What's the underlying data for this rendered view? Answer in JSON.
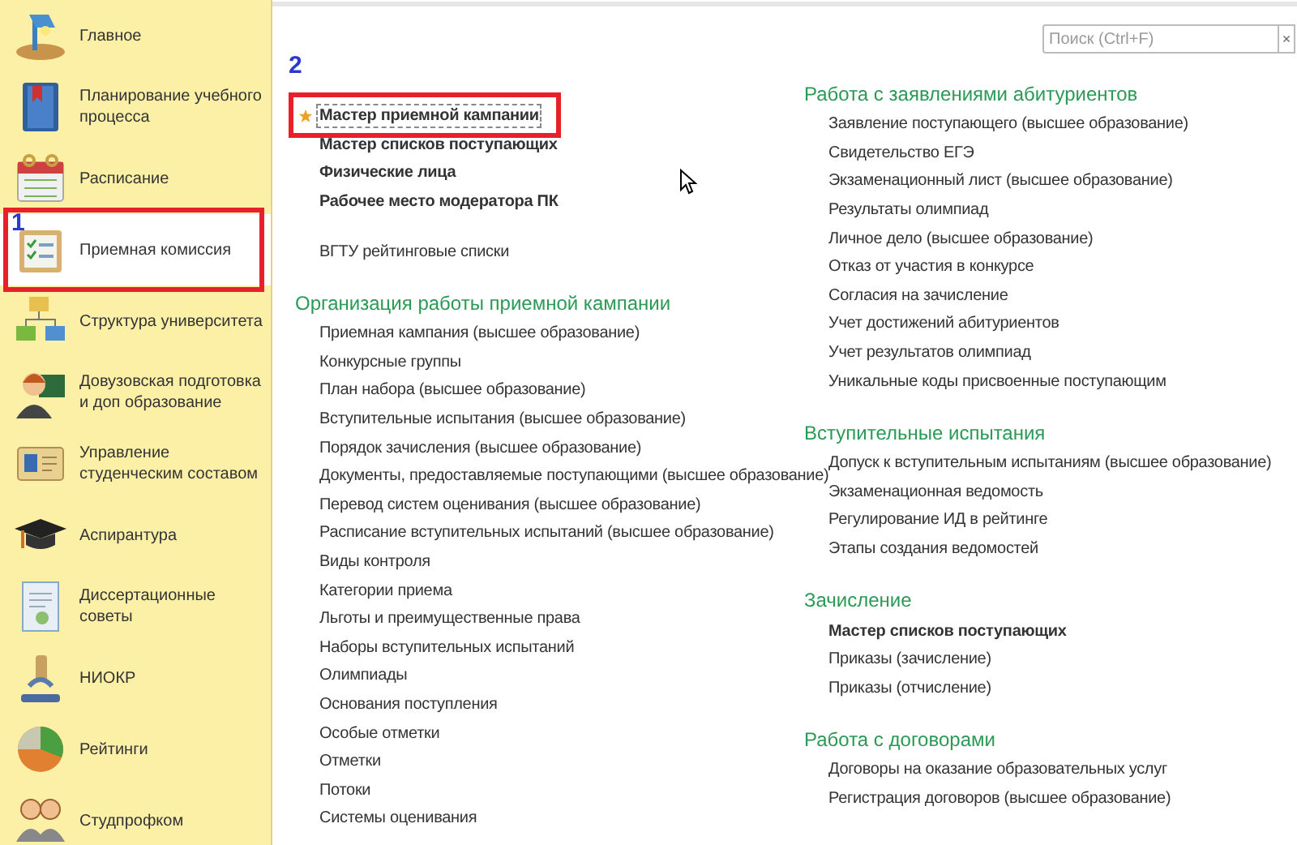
{
  "sidebar": {
    "items": [
      {
        "label": "Главное",
        "selected": false
      },
      {
        "label": "Планирование учебного процесса",
        "selected": false
      },
      {
        "label": "Расписание",
        "selected": false
      },
      {
        "label": "Приемная комиссия",
        "selected": true,
        "annotation": "1"
      },
      {
        "label": "Структура университета",
        "selected": false
      },
      {
        "label": "Довузовская подготовка и доп образование",
        "selected": false
      },
      {
        "label": "Управление студенческим составом",
        "selected": false
      },
      {
        "label": "Аспирантура",
        "selected": false
      },
      {
        "label": "Диссертационные советы",
        "selected": false
      },
      {
        "label": "НИОКР",
        "selected": false
      },
      {
        "label": "Рейтинги",
        "selected": false
      },
      {
        "label": "Студпрофком",
        "selected": false
      }
    ]
  },
  "search": {
    "placeholder": "Поиск (Ctrl+F)",
    "clear": "×"
  },
  "columns": [
    {
      "groups": [
        {
          "items": [
            {
              "label": "Мастер приемной кампании",
              "bold": true,
              "favorite": true,
              "focused": true,
              "annotation": "2"
            },
            {
              "label": "Мастер списков поступающих",
              "bold": true,
              "favorite": false,
              "focused": false
            },
            {
              "label": "Физические лица",
              "bold": true,
              "favorite": false,
              "focused": false
            },
            {
              "label": "Рабочее место модератора ПК",
              "bold": true,
              "favorite": false,
              "focused": false
            }
          ]
        },
        {
          "items": [
            {
              "label": "ВГТУ рейтинговые списки",
              "bold": false,
              "favorite": false,
              "focused": false
            }
          ]
        },
        {
          "heading": "Организация работы приемной кампании",
          "items": [
            {
              "label": "Приемная кампания (высшее образование)",
              "bold": false,
              "favorite": false,
              "focused": false
            },
            {
              "label": "Конкурсные группы",
              "bold": false,
              "favorite": false,
              "focused": false
            },
            {
              "label": "План набора (высшее образование)",
              "bold": false,
              "favorite": false,
              "focused": false
            },
            {
              "label": "Вступительные испытания (высшее образование)",
              "bold": false,
              "favorite": false,
              "focused": false
            },
            {
              "label": "Порядок зачисления (высшее образование)",
              "bold": false,
              "favorite": false,
              "focused": false
            },
            {
              "label": "Документы, предоставляемые поступающими (высшее образование)",
              "bold": false,
              "favorite": false,
              "focused": false
            },
            {
              "label": "Перевод систем оценивания (высшее образование)",
              "bold": false,
              "favorite": false,
              "focused": false
            },
            {
              "label": "Расписание вступительных испытаний (высшее образование)",
              "bold": false,
              "favorite": false,
              "focused": false
            },
            {
              "label": "Виды контроля",
              "bold": false,
              "favorite": false,
              "focused": false
            },
            {
              "label": "Категории приема",
              "bold": false,
              "favorite": false,
              "focused": false
            },
            {
              "label": "Льготы и преимущественные права",
              "bold": false,
              "favorite": false,
              "focused": false
            },
            {
              "label": "Наборы вступительных испытаний",
              "bold": false,
              "favorite": false,
              "focused": false
            },
            {
              "label": "Олимпиады",
              "bold": false,
              "favorite": false,
              "focused": false
            },
            {
              "label": "Основания поступления",
              "bold": false,
              "favorite": false,
              "focused": false
            },
            {
              "label": "Особые отметки",
              "bold": false,
              "favorite": false,
              "focused": false
            },
            {
              "label": "Отметки",
              "bold": false,
              "favorite": false,
              "focused": false
            },
            {
              "label": "Потоки",
              "bold": false,
              "favorite": false,
              "focused": false
            },
            {
              "label": "Системы оценивания",
              "bold": false,
              "favorite": false,
              "focused": false
            }
          ]
        }
      ]
    },
    {
      "groups": [
        {
          "heading": "Работа с заявлениями абитуриентов",
          "items": [
            {
              "label": "Заявление поступающего (высшее образование)",
              "bold": false,
              "favorite": false,
              "focused": false
            },
            {
              "label": "Свидетельство ЕГЭ",
              "bold": false,
              "favorite": false,
              "focused": false
            },
            {
              "label": "Экзаменационный лист (высшее образование)",
              "bold": false,
              "favorite": false,
              "focused": false
            },
            {
              "label": "Результаты олимпиад",
              "bold": false,
              "favorite": false,
              "focused": false
            },
            {
              "label": "Личное дело (высшее образование)",
              "bold": false,
              "favorite": false,
              "focused": false
            },
            {
              "label": "Отказ от участия в конкурсе",
              "bold": false,
              "favorite": false,
              "focused": false
            },
            {
              "label": "Согласия на зачисление",
              "bold": false,
              "favorite": false,
              "focused": false
            },
            {
              "label": "Учет достижений абитуриентов",
              "bold": false,
              "favorite": false,
              "focused": false
            },
            {
              "label": "Учет результатов олимпиад",
              "bold": false,
              "favorite": false,
              "focused": false
            },
            {
              "label": "Уникальные коды присвоенные поступающим",
              "bold": false,
              "favorite": false,
              "focused": false
            }
          ]
        },
        {
          "heading": "Вступительные испытания",
          "items": [
            {
              "label": "Допуск к вступительным испытаниям (высшее образование)",
              "bold": false,
              "favorite": false,
              "focused": false
            },
            {
              "label": "Экзаменационная ведомость",
              "bold": false,
              "favorite": false,
              "focused": false
            },
            {
              "label": "Регулирование ИД в рейтинге",
              "bold": false,
              "favorite": false,
              "focused": false
            },
            {
              "label": "Этапы создания ведомостей",
              "bold": false,
              "favorite": false,
              "focused": false
            }
          ]
        },
        {
          "heading": "Зачисление",
          "items": [
            {
              "label": "Мастер списков поступающих",
              "bold": true,
              "favorite": false,
              "focused": false
            },
            {
              "label": "Приказы (зачисление)",
              "bold": false,
              "favorite": false,
              "focused": false
            },
            {
              "label": "Приказы (отчисление)",
              "bold": false,
              "favorite": false,
              "focused": false
            }
          ]
        },
        {
          "heading": "Работа с договорами",
          "items": [
            {
              "label": "Договоры на оказание образовательных услуг",
              "bold": false,
              "favorite": false,
              "focused": false
            },
            {
              "label": "Регистрация договоров (высшее образование)",
              "bold": false,
              "favorite": false,
              "focused": false
            }
          ]
        }
      ]
    }
  ]
}
